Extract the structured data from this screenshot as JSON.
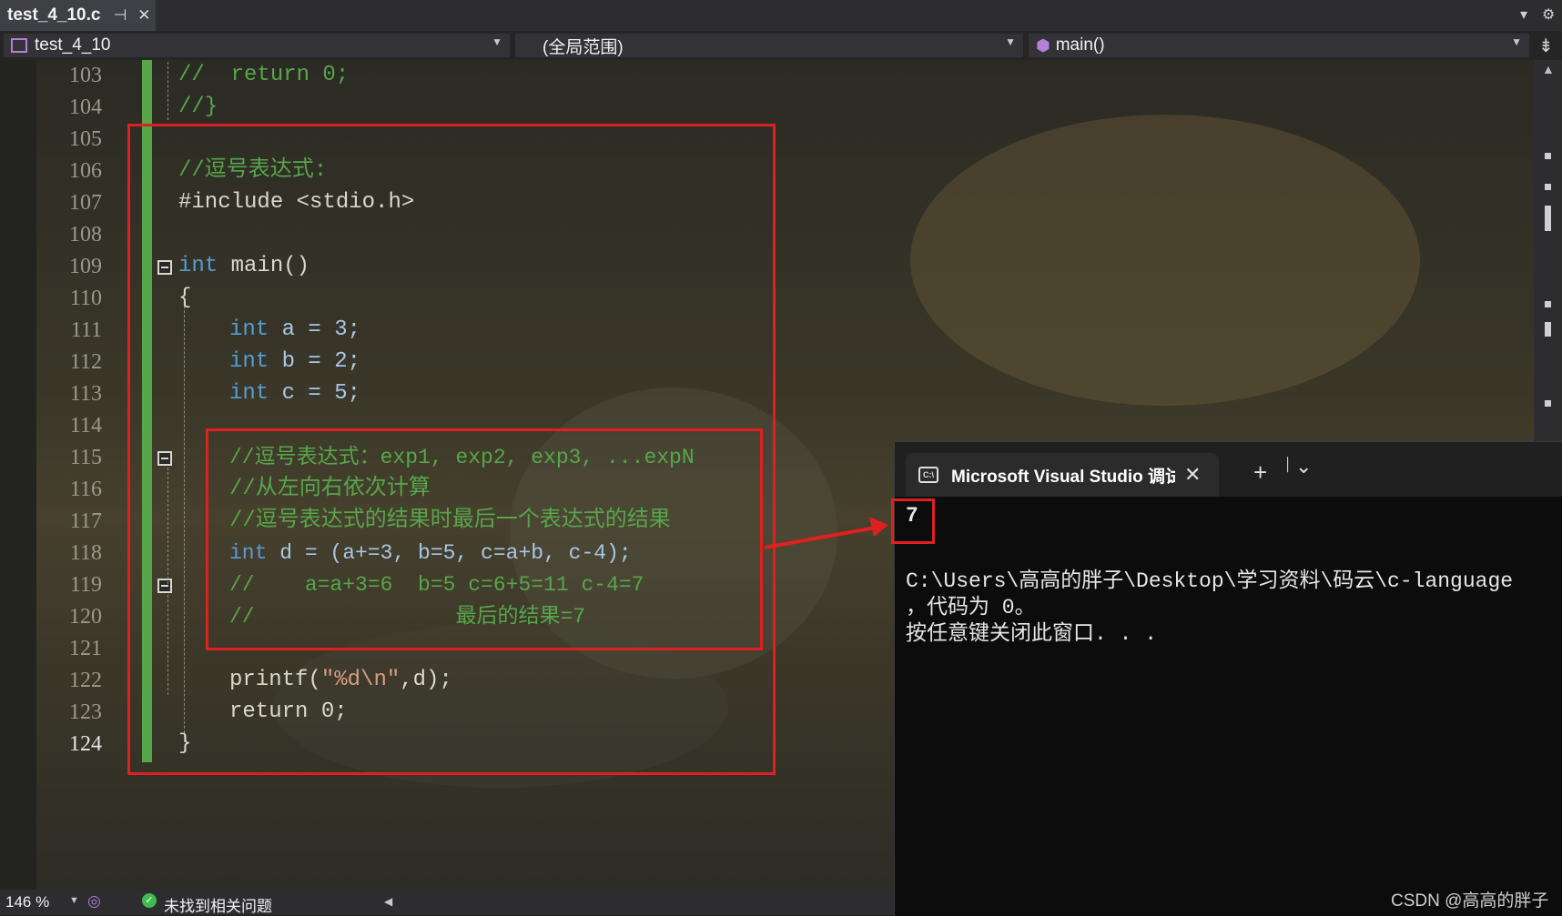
{
  "tab": {
    "filename": "test_4_10.c",
    "pin_glyph": "⊣",
    "close_glyph": "✕"
  },
  "nav": {
    "project": "test_4_10",
    "scope": "(全局范围)",
    "function": "main()"
  },
  "editor": {
    "lines": [
      {
        "num": "103"
      },
      {
        "num": "104"
      },
      {
        "num": "105"
      },
      {
        "num": "106"
      },
      {
        "num": "107"
      },
      {
        "num": "108"
      },
      {
        "num": "109"
      },
      {
        "num": "110"
      },
      {
        "num": "111"
      },
      {
        "num": "112"
      },
      {
        "num": "113"
      },
      {
        "num": "114"
      },
      {
        "num": "115"
      },
      {
        "num": "116"
      },
      {
        "num": "117"
      },
      {
        "num": "118"
      },
      {
        "num": "119"
      },
      {
        "num": "120"
      },
      {
        "num": "121"
      },
      {
        "num": "122"
      },
      {
        "num": "123"
      },
      {
        "num": "124"
      }
    ],
    "code": {
      "l103": "//  return 0;",
      "l104": "//}",
      "l106": "//逗号表达式:",
      "l107": "#include <stdio.h>",
      "l109_kw": "int",
      "l109_rest": " main()",
      "l110": "{",
      "l111_kw": "int",
      "l111_rest": " a = 3;",
      "l112_kw": "int",
      "l112_rest": " b = 2;",
      "l113_kw": "int",
      "l113_rest": " c = 5;",
      "l115": "//逗号表达式：exp1, exp2, exp3, ...expN",
      "l116": "//从左向右依次计算",
      "l117": "//逗号表达式的结果时最后一个表达式的结果",
      "l118_kw": "int",
      "l118_rest": " d = (a+=3, b=5, c=a+b, c-4);",
      "l119": "//    a=a+3=6  b=5 c=6+5=11 c-4=7",
      "l120": "//                最后的结果=7",
      "l122_fn": "printf(",
      "l122_str": "\"%d\\n\"",
      "l122_rest": ",d);",
      "l123": "return 0;",
      "l124": "}"
    }
  },
  "terminal": {
    "tab_title": "Microsoft Visual Studio 调试控制台",
    "icon_text": "C:\\",
    "close_glyph": "✕",
    "add_glyph": "+",
    "menu_glyph": "⌄",
    "output_value": "7",
    "path_line": "C:\\Users\\高高的胖子\\Desktop\\学习资料\\码云\\c-language",
    "exit_line": "，代码为 0。",
    "press_line": "按任意键关闭此窗口. . ."
  },
  "status": {
    "zoom": "146 %",
    "issues": "未找到相关问题"
  },
  "watermark": "CSDN @高高的胖子",
  "colors": {
    "comment": "#57a64a",
    "keyword": "#569cd6",
    "annotation_red": "#e02020",
    "gutter_green": "#57a64a"
  }
}
